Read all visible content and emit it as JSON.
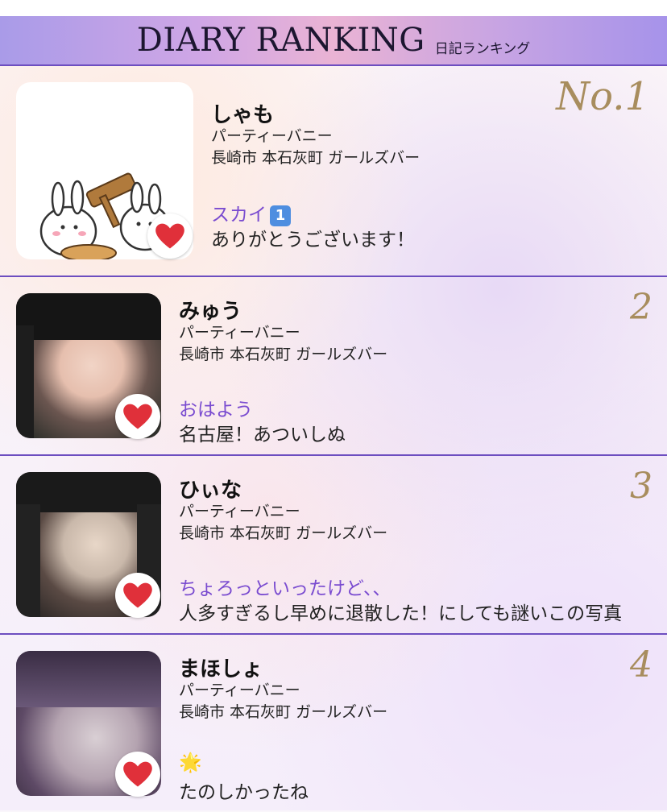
{
  "header": {
    "title": "DIARY RANKING",
    "subtitle": "日記ランキング"
  },
  "entries": [
    {
      "rank": "No.1",
      "name": "しゃも",
      "shop": "パーティーバニー",
      "area": "長崎市 本石灰町 ガールズバー",
      "diary_title": "スカイ",
      "diary_emoji": "1",
      "diary_body": "ありがとうございます！"
    },
    {
      "rank": "2",
      "name": "みゅう",
      "shop": "パーティーバニー",
      "area": "長崎市 本石灰町 ガールズバー",
      "diary_title": "おはよう",
      "diary_body": "名古屋！あついしぬ"
    },
    {
      "rank": "3",
      "name": "ひぃな",
      "shop": "パーティーバニー",
      "area": "長崎市 本石灰町 ガールズバー",
      "diary_title": "ちょろっといったけど、、",
      "diary_body": "人多すぎるし早めに退散した！にしても謎いこの写真"
    },
    {
      "rank": "4",
      "name": "まほしょ",
      "shop": "パーティーバニー",
      "area": "長崎市 本石灰町 ガールズバー",
      "diary_title": "🌟",
      "diary_body": "たのしかったね"
    }
  ],
  "colors": {
    "accent": "#6d4ec0",
    "title_purple": "#7a4cd0",
    "rank_gold": "#a88d5e",
    "heart_red": "#e0303a"
  }
}
